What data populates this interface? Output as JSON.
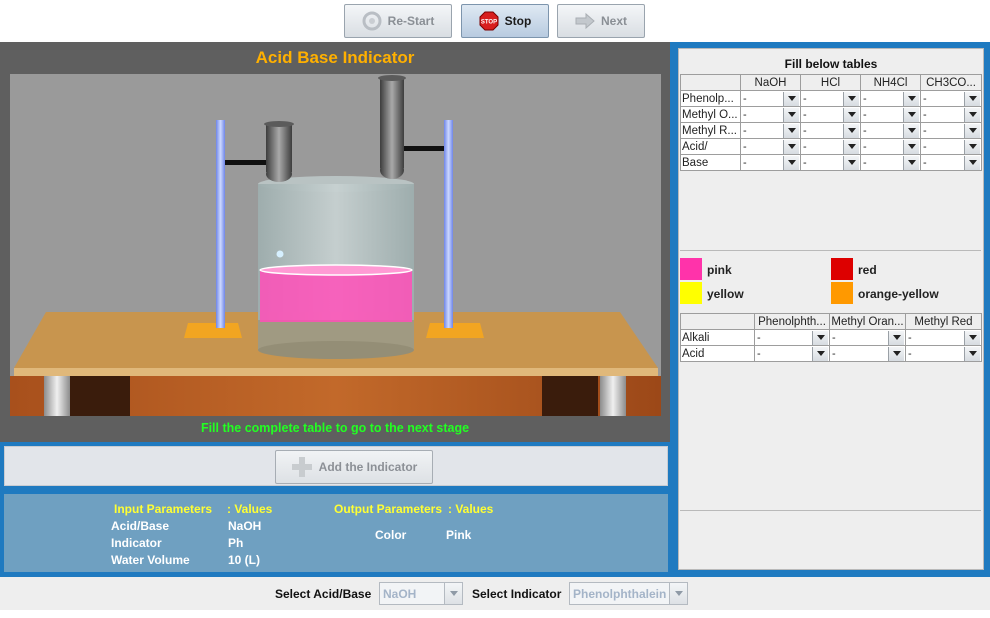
{
  "toolbar": {
    "restart_label": "Re-Start",
    "stop_label": "Stop",
    "stop_icon_text": "STOP",
    "next_label": "Next"
  },
  "simulation": {
    "title": "Acid Base Indicator",
    "message": "Fill the complete table to go to the next stage",
    "add_indicator_label": "Add the Indicator",
    "solution_color": "#ff4fb8"
  },
  "parameters": {
    "input_header": "Input Parameters",
    "input_values_header": ": Values",
    "output_header": "Output Parameters",
    "output_values_header": ": Values",
    "inputs": [
      {
        "name": "Acid/Base",
        "value": "NaOH"
      },
      {
        "name": "Indicator",
        "value": "Ph"
      },
      {
        "name": "Water Volume",
        "value": "10 (L)"
      }
    ],
    "outputs": [
      {
        "name": "Color",
        "value": "Pink"
      }
    ]
  },
  "tables": {
    "title": "Fill below tables",
    "table1": {
      "columns": [
        "NaOH",
        "HCl",
        "NH4Cl",
        "CH3CO..."
      ],
      "rows": [
        "Phenolp...",
        "Methyl O...",
        "Methyl R...",
        "Acid/",
        "Base"
      ],
      "cell_value": "-"
    },
    "legend": [
      {
        "label": "pink",
        "color": "#ff33aa"
      },
      {
        "label": "red",
        "color": "#dd0000"
      },
      {
        "label": "yellow",
        "color": "#ffff00"
      },
      {
        "label": "orange-yellow",
        "color": "#ff9900"
      }
    ],
    "table2": {
      "columns": [
        "Phenolphth...",
        "Methyl Oran...",
        "Methyl Red"
      ],
      "rows": [
        "Alkali",
        "Acid"
      ],
      "cell_value": "-"
    }
  },
  "bottom": {
    "acid_base_label": "Select Acid/Base",
    "acid_base_value": "NaOH",
    "indicator_label": "Select Indicator",
    "indicator_value": "Phenolphthalein"
  }
}
